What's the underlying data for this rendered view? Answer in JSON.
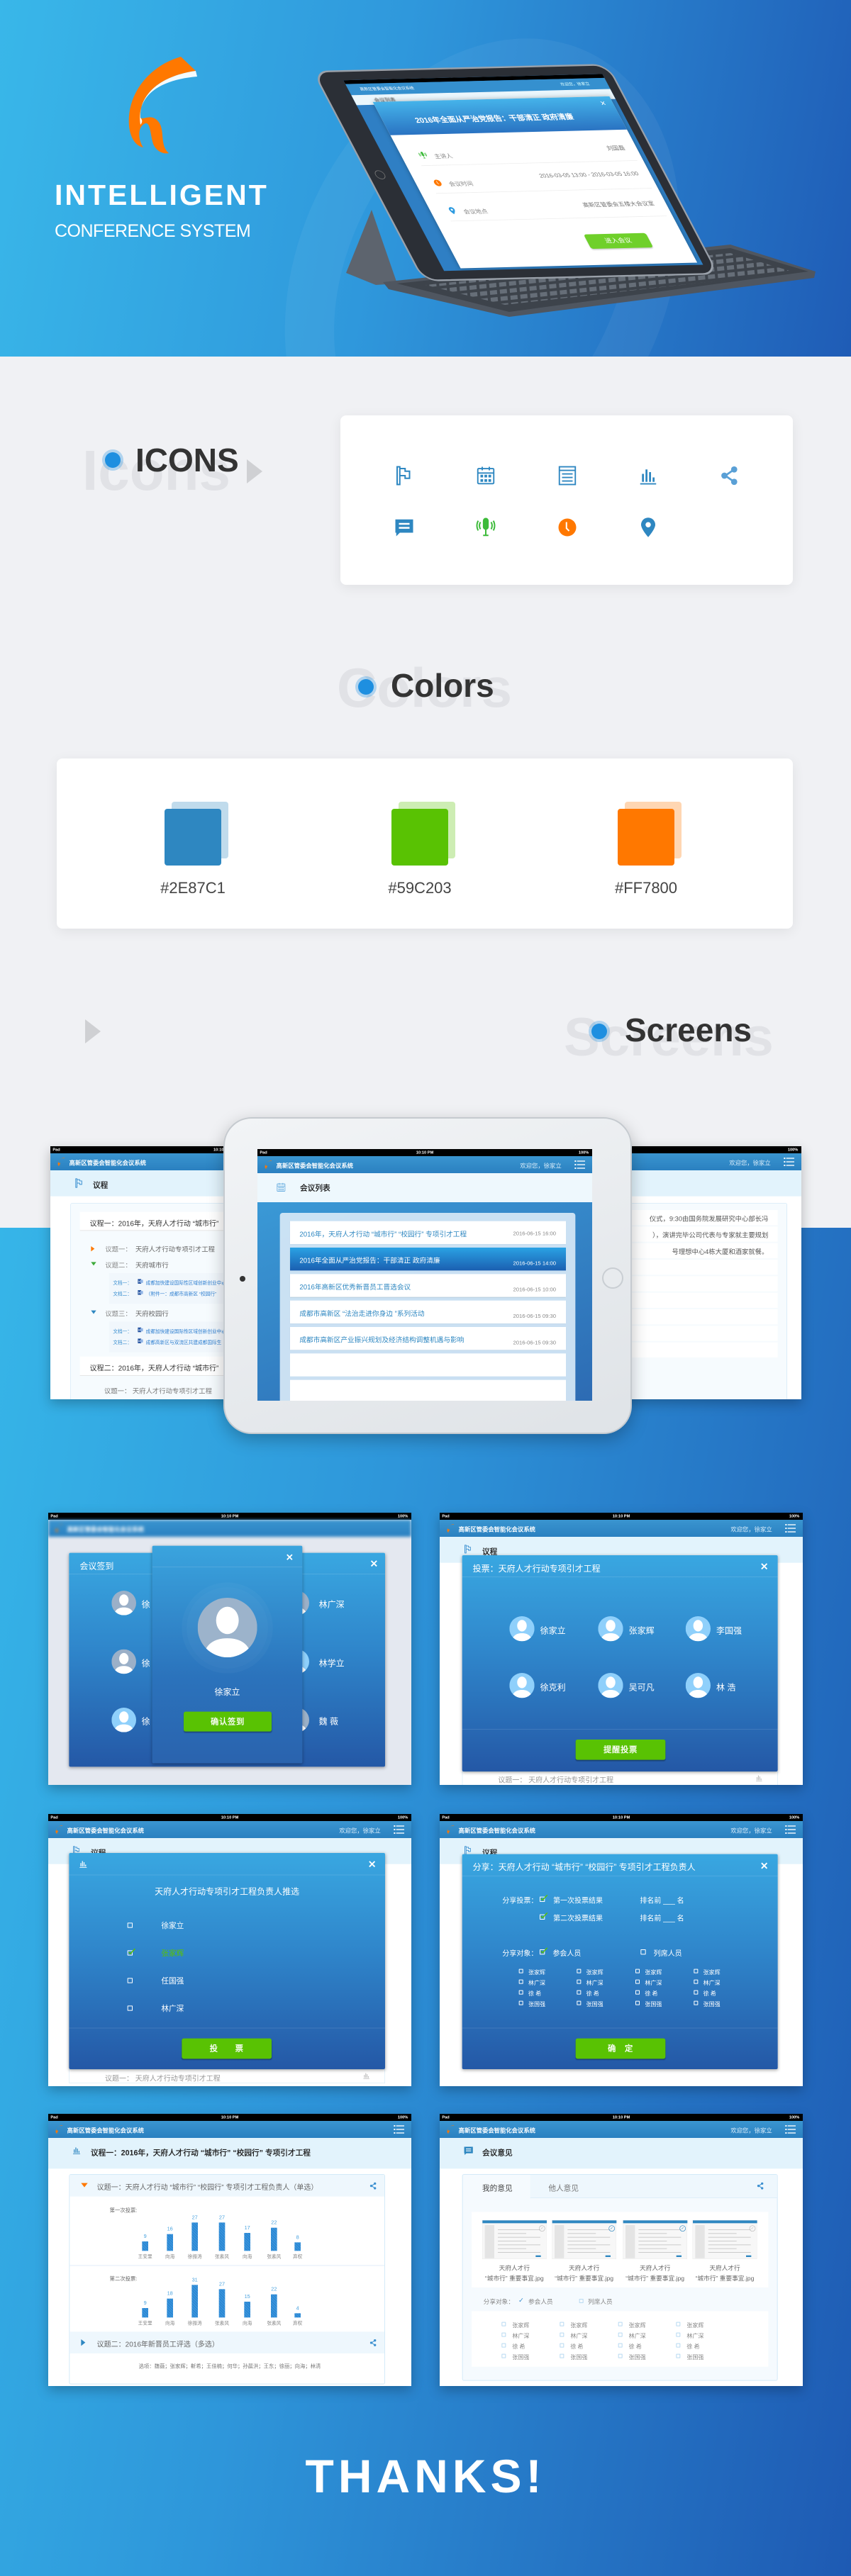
{
  "hero": {
    "title": "INTELLIGENT",
    "subtitle": "CONFERENCE SYSTEM",
    "tablet": {
      "section": "会议列表",
      "meeting_title": "2016年全面从严治党报告：干部清正 政府清廉",
      "rows": [
        {
          "icon": "mic-icon",
          "label": "主讲人",
          "value": "刘国磊"
        },
        {
          "icon": "clock-icon",
          "label": "会议时间",
          "value": "2016-03-05 13:00 - 2016-03-05 16:00"
        },
        {
          "icon": "pin-icon",
          "label": "会议地点",
          "value": "高新区管委会五楼大会议室"
        }
      ],
      "enter_button": "进入会议"
    }
  },
  "icons_section": {
    "ghost": "Icons",
    "title": "ICONS",
    "icons": [
      "flag-icon",
      "calendar-icon",
      "list-icon",
      "bar-chart-icon",
      "share-icon",
      "chat-icon",
      "mic-icon",
      "clock-icon",
      "pin-icon"
    ]
  },
  "colors_section": {
    "ghost": "Colors",
    "title": "Colors",
    "swatches": [
      {
        "hex": "#2E87C1",
        "label": "#2E87C1"
      },
      {
        "hex": "#59C203",
        "label": "#59C203"
      },
      {
        "hex": "#FF7800",
        "label": "#FF7800"
      }
    ]
  },
  "screens_section": {
    "ghost": "Screens",
    "title": "Screens"
  },
  "app": {
    "status": {
      "carrier": "Pad",
      "time": "10:10 PM",
      "battery": "100%",
      "time_short": "10:10",
      "pm": "PM"
    },
    "title": "高新区管委会智能化会议系统",
    "welcome": "欢迎您，徐家立"
  },
  "showcase": {
    "left": {
      "section": "议程",
      "agenda1": "议程一：2016年，天府人才行动 “城市行”",
      "topics": [
        {
          "label": "议题一：",
          "text": "天府人才行动专项引才工程",
          "color": "#FF7800"
        },
        {
          "label": "议题二：",
          "text": "天府城市行",
          "color": "#3DAA3A",
          "docs": [
            {
              "label": "文档一：",
              "text": "成都加快建设国际性区域创新创业中心"
            },
            {
              "label": "文档二：",
              "text": "（附件一：成都市高新区 “校园行”"
            }
          ]
        },
        {
          "label": "议题三：",
          "text": "天府校园行",
          "color": "#2E87C1",
          "docs": [
            {
              "label": "文档一：",
              "text": "成都加快建设国际性区域创新创业中心"
            },
            {
              "label": "文档二：",
              "text": "成都高新区与双流区共建成都国际生"
            }
          ]
        }
      ],
      "agenda2": "议程二：2016年，天府人才行动 “城市行”",
      "agenda2_topic": "议题一：  天府人才行动专项引才工程"
    },
    "center": {
      "section": "会议列表",
      "meetings": [
        {
          "title": "2016年，天府人才行动 “城市行”  “校园行” 专项引才工程",
          "date": "2016-06-15  16:00",
          "active": false
        },
        {
          "title": "2016年全面从严治党报告：干部清正 政府清廉",
          "date": "2016-06-15  14:00",
          "active": true
        },
        {
          "title": "2016年高新区优秀新晋员工晋选会议",
          "date": "2016-06-15  10:00",
          "active": false
        },
        {
          "title": "成都市高新区 “法治走进你身边 ”系列活动",
          "date": "2016-06-15  09:30",
          "active": false
        },
        {
          "title": "成都市高新区产业振兴规划及经济结构调整机遇与影响",
          "date": "2016-06-15  09:30",
          "active": false
        }
      ],
      "empty_rows": 2
    },
    "right": {
      "lines": [
        "仪式，9:30由国务院发展研究中心部长冯",
        "），演讲完毕公司代表与专家就主要规划",
        "号理想中心4栋大厦和酒家就餐。"
      ]
    }
  },
  "screens": {
    "signin": {
      "title": "会议签到",
      "left_names": [
        "徐",
        "徐",
        "徐"
      ],
      "right_names": [
        "林广深",
        "林学立",
        "魏  薇"
      ],
      "selected_name": "徐家立",
      "confirm_button": "确认签到"
    },
    "vote_remind": {
      "section": "议程",
      "title": "投票：天府人才行动专项引才工程",
      "people": [
        "徐家立",
        "张家辉",
        "李国强",
        "徐克利",
        "吴可凡",
        "林  浩"
      ],
      "remind_button": "提醒投票",
      "below": "议题一：  天府人才行动专项引才工程"
    },
    "vote": {
      "section": "议程",
      "question": "天府人才行动专项引才工程负责人推选",
      "options": [
        {
          "name": "徐家立",
          "checked": false
        },
        {
          "name": "张家辉",
          "checked": true
        },
        {
          "name": "任国强",
          "checked": false
        },
        {
          "name": "林广深",
          "checked": false
        }
      ],
      "vote_button": "投　　票",
      "below": "议题一：  天府人才行动专项引才工程"
    },
    "share": {
      "section": "议程",
      "title": "分享：天府人才行动 “城市行”  “校园行” 专项引才工程负责人",
      "share_vote_label": "分享投票：",
      "results": [
        {
          "label": "第一次投票结果",
          "checked": true,
          "rank": "排名前 ___ 名"
        },
        {
          "label": "第二次投票结果",
          "checked": true,
          "rank": "排名前 ___ 名"
        }
      ],
      "target_label": "分享对象：",
      "targets": [
        {
          "label": "参会人员",
          "checked": true
        },
        {
          "label": "列席人员",
          "checked": false
        }
      ],
      "people": [
        "张家辉",
        "林广深",
        "徐  希",
        "张国强"
      ],
      "columns": 4,
      "confirm_button": "确　定"
    },
    "results": {
      "section": "议程一：2016年，天府人才行动 “城市行”  “校园行” 专项引才工程",
      "topic1": "议题一：天府人才行动 “城市行”  “校园行” 专项引才工程负责人（单选）",
      "rounds": [
        {
          "label": "第一次投票:",
          "candidates": [
            "王安里",
            "向海",
            "徐振涛",
            "张素风",
            "向海",
            "张素风",
            "弃权"
          ],
          "votes": [
            9,
            16,
            27,
            27,
            17,
            22,
            8
          ]
        },
        {
          "label": "第二次投票:",
          "candidates": [
            "王安里",
            "向海",
            "徐振涛",
            "张素风",
            "向海",
            "张素风",
            "弃权"
          ],
          "votes": [
            9,
            18,
            31,
            27,
            15,
            22,
            4
          ]
        }
      ],
      "topic2": "议题二：2016年新晋员工评选（多选）",
      "options": "选项：魏薇；张家辉；靳希；王佳楠；何华；孙晨洪；王东；徐丽；向海；林清"
    },
    "opinions": {
      "section": "会议意见",
      "tabs": [
        {
          "label": "我的意见",
          "active": true
        },
        {
          "label": "他人意见",
          "active": false
        }
      ],
      "files": [
        {
          "line1": "天府人才行",
          "line2": "“城市行” 重要事宜.jpg",
          "selected": false
        },
        {
          "line1": "天府人才行",
          "line2": "“城市行” 重要事宜.jpg",
          "selected": true
        },
        {
          "line1": "天府人才行",
          "line2": "“城市行” 重要事宜.jpg",
          "selected": true
        },
        {
          "line1": "天府人才行",
          "line2": "“城市行” 重要事宜.jpg",
          "selected": false
        }
      ],
      "target_label": "分享对象：",
      "targets": [
        {
          "label": "参会人员",
          "checked": true
        },
        {
          "label": "列席人员",
          "checked": false
        }
      ],
      "people": [
        "张家辉",
        "林广深",
        "徐  希",
        "张国强"
      ],
      "columns": 4
    }
  },
  "colors": {
    "blue": "#2E87C1",
    "green": "#59C203",
    "orange": "#FF7800"
  },
  "thanks": "THANKS!"
}
